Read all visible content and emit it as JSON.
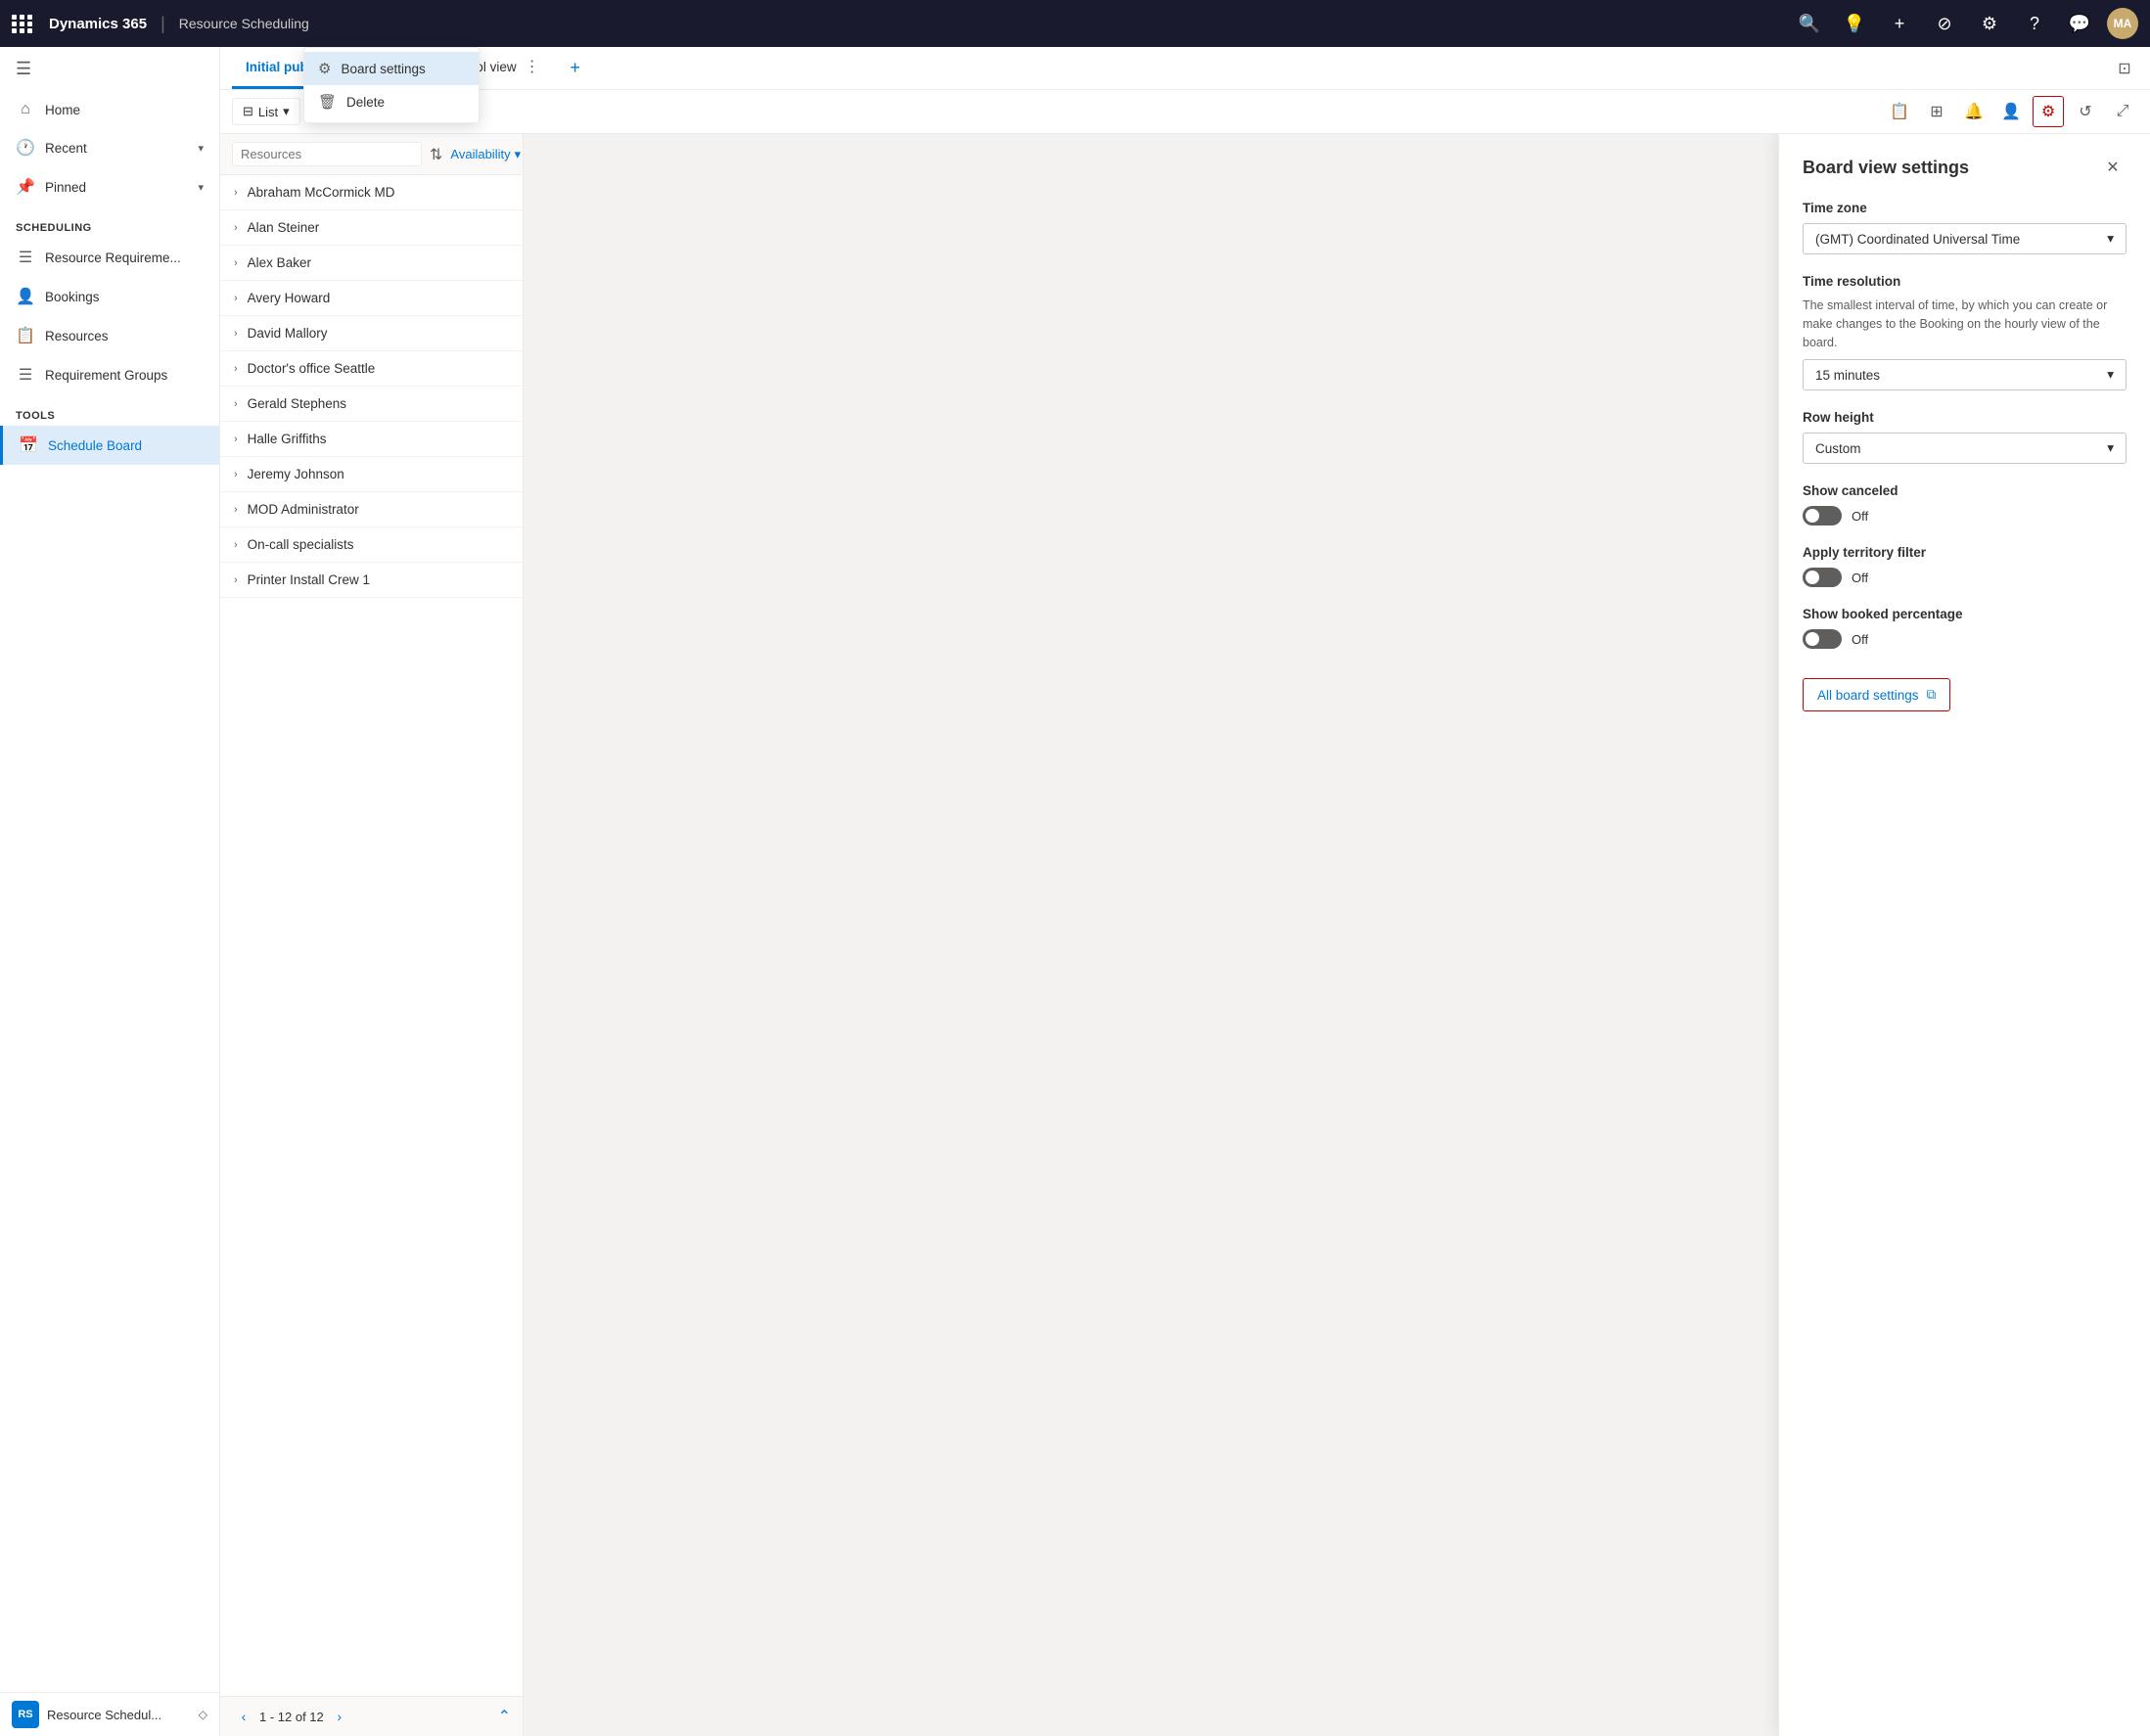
{
  "topNav": {
    "brand": "Dynamics 365",
    "separator": "|",
    "module": "Resource Scheduling",
    "icons": {
      "search": "🔍",
      "lightbulb": "💡",
      "add": "+",
      "filter": "⊘",
      "settings": "⚙",
      "help": "?",
      "chat": "💬"
    },
    "avatar": "MA"
  },
  "sidebar": {
    "hamburger": "☰",
    "navItems": [
      {
        "label": "Home",
        "icon": "⌂"
      },
      {
        "label": "Recent",
        "icon": "🕐",
        "hasChevron": true
      },
      {
        "label": "Pinned",
        "icon": "📌",
        "hasChevron": true
      }
    ],
    "schedulingSection": "Scheduling",
    "schedulingItems": [
      {
        "label": "Resource Requireme...",
        "icon": "☰"
      },
      {
        "label": "Bookings",
        "icon": "👤"
      },
      {
        "label": "Resources",
        "icon": "📋"
      },
      {
        "label": "Requirement Groups",
        "icon": "☰"
      }
    ],
    "toolsSection": "Tools",
    "toolsItems": [
      {
        "label": "Schedule Board",
        "icon": "📅",
        "active": true
      }
    ],
    "bottomItem": {
      "abbr": "RS",
      "text": "Resource Schedul...",
      "diamondIcon": "◇"
    }
  },
  "tabs": {
    "items": [
      {
        "label": "Initial public view",
        "active": true
      },
      {
        "label": "On-call pool view",
        "active": false
      }
    ],
    "moreMenuIcon": "⋮",
    "addIcon": "+"
  },
  "toolbar": {
    "listLabel": "List",
    "listChevron": "▾",
    "moreIcon": "···",
    "rightIcons": {
      "report": "📋",
      "table": "⊞",
      "alert": "🔔",
      "person": "👤",
      "settings": "⚙",
      "refresh": "↺",
      "expand": "⤢"
    }
  },
  "resourceList": {
    "searchPlaceholder": "Resources",
    "availabilityLabel": "Availability",
    "items": [
      {
        "name": "Abraham McCormick MD"
      },
      {
        "name": "Alan Steiner"
      },
      {
        "name": "Alex Baker"
      },
      {
        "name": "Avery Howard"
      },
      {
        "name": "David Mallory"
      },
      {
        "name": "Doctor's office Seattle"
      },
      {
        "name": "Gerald Stephens"
      },
      {
        "name": "Halle Griffiths"
      },
      {
        "name": "Jeremy Johnson"
      },
      {
        "name": "MOD Administrator"
      },
      {
        "name": "On-call specialists"
      },
      {
        "name": "Printer Install Crew 1"
      }
    ],
    "pagination": {
      "current": "1 - 12 of 12"
    }
  },
  "contextMenu": {
    "boardSettingsLabel": "Board settings",
    "boardSettingsIcon": "⚙",
    "deleteLabel": "Delete",
    "deleteIcon": "🗑"
  },
  "boardViewSettings": {
    "title": "Board view settings",
    "timeZoneLabel": "Time zone",
    "timeZoneValue": "(GMT) Coordinated Universal Time",
    "timeResolutionLabel": "Time resolution",
    "timeResolutionDesc": "The smallest interval of time, by which you can create or make changes to the Booking on the hourly view of the board.",
    "timeResolutionValue": "15 minutes",
    "rowHeightLabel": "Row height",
    "rowHeightValue": "Custom",
    "showCanceledLabel": "Show canceled",
    "showCanceledValue": "Off",
    "applyTerritoryLabel": "Apply territory filter",
    "applyTerritoryValue": "Off",
    "showBookedLabel": "Show booked percentage",
    "showBookedValue": "Off",
    "allBoardSettingsLabel": "All board settings",
    "allBoardSettingsIcon": "⧉"
  }
}
